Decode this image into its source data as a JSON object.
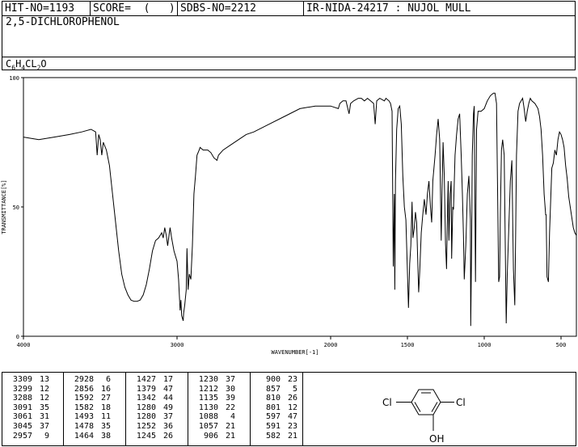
{
  "header": {
    "hit": "HIT-NO=1193",
    "score": "SCORE=  (   )",
    "sdbs": "SDBS-NO=2212",
    "ir": "IR-NIDA-24217 : NUJOL MULL",
    "compound": "2,5-DICHLOROPHENOL",
    "formula": {
      "c": "C",
      "c_n": "6",
      "h": "H",
      "h_n": "4",
      "cl": "CL",
      "cl_n": "2",
      "o": "O"
    }
  },
  "chart_data": {
    "type": "line",
    "xlabel": "WAVENUMBER[-1]",
    "ylabel": "TRANSMITTANCE[%]",
    "xlim": [
      4000,
      400
    ],
    "ylim": [
      0,
      100
    ],
    "x_ticks": [
      "4000",
      "3000",
      "2000",
      "1500",
      "1000",
      "500"
    ],
    "x_tick_values": [
      4000,
      3000,
      2000,
      1500,
      1000,
      500
    ],
    "y_ticks": [
      "0",
      "50",
      "100"
    ],
    "y_tick_values": [
      0,
      50,
      100
    ],
    "grid": false,
    "series": [
      {
        "points": [
          [
            4000,
            77
          ],
          [
            3900,
            76
          ],
          [
            3800,
            77
          ],
          [
            3700,
            78
          ],
          [
            3620,
            79
          ],
          [
            3560,
            80
          ],
          [
            3530,
            79
          ],
          [
            3520,
            70
          ],
          [
            3510,
            78
          ],
          [
            3500,
            76
          ],
          [
            3490,
            70
          ],
          [
            3480,
            75
          ],
          [
            3460,
            72
          ],
          [
            3440,
            66
          ],
          [
            3420,
            55
          ],
          [
            3400,
            44
          ],
          [
            3380,
            33
          ],
          [
            3360,
            24
          ],
          [
            3340,
            19
          ],
          [
            3320,
            16
          ],
          [
            3300,
            14
          ],
          [
            3280,
            13.5
          ],
          [
            3260,
            13.5
          ],
          [
            3240,
            14
          ],
          [
            3220,
            16
          ],
          [
            3200,
            20
          ],
          [
            3180,
            26
          ],
          [
            3160,
            33
          ],
          [
            3140,
            37
          ],
          [
            3120,
            38
          ],
          [
            3100,
            40
          ],
          [
            3090,
            38
          ],
          [
            3080,
            42
          ],
          [
            3070,
            39
          ],
          [
            3061,
            35
          ],
          [
            3050,
            40
          ],
          [
            3045,
            42
          ],
          [
            3035,
            38
          ],
          [
            3020,
            33
          ],
          [
            3000,
            29
          ],
          [
            2990,
            22
          ],
          [
            2980,
            10
          ],
          [
            2975,
            14
          ],
          [
            2970,
            8
          ],
          [
            2960,
            6
          ],
          [
            2957,
            9
          ],
          [
            2950,
            12
          ],
          [
            2940,
            18
          ],
          [
            2935,
            34
          ],
          [
            2928,
            18
          ],
          [
            2920,
            24
          ],
          [
            2910,
            22
          ],
          [
            2900,
            35
          ],
          [
            2890,
            55
          ],
          [
            2880,
            62
          ],
          [
            2870,
            70
          ],
          [
            2856,
            72
          ],
          [
            2850,
            73
          ],
          [
            2830,
            72
          ],
          [
            2800,
            72
          ],
          [
            2780,
            71
          ],
          [
            2760,
            69
          ],
          [
            2740,
            68
          ],
          [
            2730,
            70
          ],
          [
            2700,
            72
          ],
          [
            2650,
            74
          ],
          [
            2600,
            76
          ],
          [
            2550,
            78
          ],
          [
            2500,
            79
          ],
          [
            2400,
            82
          ],
          [
            2300,
            85
          ],
          [
            2200,
            88
          ],
          [
            2100,
            89
          ],
          [
            2000,
            89
          ],
          [
            1950,
            88
          ],
          [
            1940,
            90
          ],
          [
            1920,
            91
          ],
          [
            1900,
            91
          ],
          [
            1880,
            86
          ],
          [
            1870,
            90
          ],
          [
            1850,
            91
          ],
          [
            1820,
            92
          ],
          [
            1800,
            92
          ],
          [
            1780,
            91
          ],
          [
            1760,
            92
          ],
          [
            1740,
            91
          ],
          [
            1720,
            90
          ],
          [
            1710,
            82
          ],
          [
            1700,
            91
          ],
          [
            1680,
            92
          ],
          [
            1650,
            91
          ],
          [
            1640,
            92
          ],
          [
            1620,
            91
          ],
          [
            1610,
            90
          ],
          [
            1600,
            87
          ],
          [
            1592,
            27
          ],
          [
            1585,
            55
          ],
          [
            1582,
            18
          ],
          [
            1578,
            60
          ],
          [
            1570,
            80
          ],
          [
            1560,
            88
          ],
          [
            1550,
            89
          ],
          [
            1540,
            82
          ],
          [
            1530,
            62
          ],
          [
            1520,
            50
          ],
          [
            1510,
            45
          ],
          [
            1493,
            11
          ],
          [
            1485,
            28
          ],
          [
            1478,
            35
          ],
          [
            1470,
            52
          ],
          [
            1464,
            38
          ],
          [
            1455,
            42
          ],
          [
            1448,
            48
          ],
          [
            1440,
            44
          ],
          [
            1433,
            30
          ],
          [
            1427,
            17
          ],
          [
            1420,
            25
          ],
          [
            1410,
            40
          ],
          [
            1400,
            47
          ],
          [
            1390,
            53
          ],
          [
            1379,
            47
          ],
          [
            1370,
            55
          ],
          [
            1360,
            60
          ],
          [
            1350,
            50
          ],
          [
            1342,
            44
          ],
          [
            1335,
            60
          ],
          [
            1320,
            70
          ],
          [
            1310,
            78
          ],
          [
            1300,
            84
          ],
          [
            1290,
            76
          ],
          [
            1280,
            37
          ],
          [
            1275,
            56
          ],
          [
            1268,
            75
          ],
          [
            1260,
            62
          ],
          [
            1252,
            36
          ],
          [
            1245,
            26
          ],
          [
            1240,
            45
          ],
          [
            1235,
            60
          ],
          [
            1230,
            37
          ],
          [
            1222,
            55
          ],
          [
            1215,
            60
          ],
          [
            1212,
            30
          ],
          [
            1205,
            50
          ],
          [
            1200,
            49
          ],
          [
            1195,
            60
          ],
          [
            1190,
            70
          ],
          [
            1180,
            78
          ],
          [
            1170,
            84
          ],
          [
            1160,
            86
          ],
          [
            1150,
            70
          ],
          [
            1142,
            55
          ],
          [
            1135,
            39
          ],
          [
            1130,
            22
          ],
          [
            1120,
            35
          ],
          [
            1110,
            55
          ],
          [
            1100,
            62
          ],
          [
            1090,
            45
          ],
          [
            1088,
            4
          ],
          [
            1082,
            35
          ],
          [
            1078,
            70
          ],
          [
            1070,
            86
          ],
          [
            1065,
            89
          ],
          [
            1057,
            21
          ],
          [
            1050,
            80
          ],
          [
            1040,
            87
          ],
          [
            1020,
            87
          ],
          [
            1000,
            88
          ],
          [
            980,
            91
          ],
          [
            960,
            93
          ],
          [
            940,
            94
          ],
          [
            930,
            94
          ],
          [
            920,
            90
          ],
          [
            906,
            21
          ],
          [
            900,
            23
          ],
          [
            895,
            48
          ],
          [
            888,
            72
          ],
          [
            880,
            76
          ],
          [
            870,
            70
          ],
          [
            860,
            20
          ],
          [
            857,
            5
          ],
          [
            850,
            24
          ],
          [
            840,
            42
          ],
          [
            830,
            60
          ],
          [
            820,
            68
          ],
          [
            810,
            26
          ],
          [
            801,
            12
          ],
          [
            795,
            40
          ],
          [
            790,
            70
          ],
          [
            780,
            87
          ],
          [
            770,
            90
          ],
          [
            760,
            91
          ],
          [
            750,
            92
          ],
          [
            740,
            88
          ],
          [
            730,
            83
          ],
          [
            720,
            87
          ],
          [
            710,
            90
          ],
          [
            700,
            92
          ],
          [
            690,
            91
          ],
          [
            670,
            90
          ],
          [
            650,
            88
          ],
          [
            640,
            85
          ],
          [
            630,
            80
          ],
          [
            620,
            70
          ],
          [
            610,
            55
          ],
          [
            600,
            47
          ],
          [
            597,
            47
          ],
          [
            591,
            23
          ],
          [
            582,
            21
          ],
          [
            575,
            40
          ],
          [
            560,
            65
          ],
          [
            550,
            67
          ],
          [
            540,
            72
          ],
          [
            530,
            70
          ],
          [
            520,
            76
          ],
          [
            510,
            79
          ],
          [
            500,
            78
          ],
          [
            490,
            76
          ],
          [
            480,
            73
          ],
          [
            470,
            66
          ],
          [
            460,
            61
          ],
          [
            450,
            54
          ],
          [
            440,
            50
          ],
          [
            430,
            46
          ],
          [
            420,
            42
          ],
          [
            410,
            40
          ],
          [
            400,
            39
          ]
        ]
      }
    ]
  },
  "peaks": [
    [
      [
        "3309",
        "13"
      ],
      [
        "3299",
        "12"
      ],
      [
        "3288",
        "12"
      ],
      [
        "3091",
        "35"
      ],
      [
        "3061",
        "31"
      ],
      [
        "3045",
        "37"
      ],
      [
        "2957",
        "9"
      ]
    ],
    [
      [
        "2928",
        "6"
      ],
      [
        "2856",
        "16"
      ],
      [
        "1592",
        "27"
      ],
      [
        "1582",
        "18"
      ],
      [
        "1493",
        "11"
      ],
      [
        "1478",
        "35"
      ],
      [
        "1464",
        "38"
      ]
    ],
    [
      [
        "1427",
        "17"
      ],
      [
        "1379",
        "47"
      ],
      [
        "1342",
        "44"
      ],
      [
        "1280",
        "49"
      ],
      [
        "1280",
        "37"
      ],
      [
        "1252",
        "36"
      ],
      [
        "1245",
        "26"
      ]
    ],
    [
      [
        "1230",
        "37"
      ],
      [
        "1212",
        "30"
      ],
      [
        "1135",
        "39"
      ],
      [
        "1130",
        "22"
      ],
      [
        "1088",
        "4"
      ],
      [
        "1057",
        "21"
      ],
      [
        "906",
        "21"
      ]
    ],
    [
      [
        "900",
        "23"
      ],
      [
        "857",
        "5"
      ],
      [
        "810",
        "26"
      ],
      [
        "801",
        "12"
      ],
      [
        "597",
        "47"
      ],
      [
        "591",
        "23"
      ],
      [
        "582",
        "21"
      ]
    ]
  ],
  "structure": {
    "left_sub": "Cl",
    "right_sub": "Cl",
    "bottom_sub": "OH"
  }
}
